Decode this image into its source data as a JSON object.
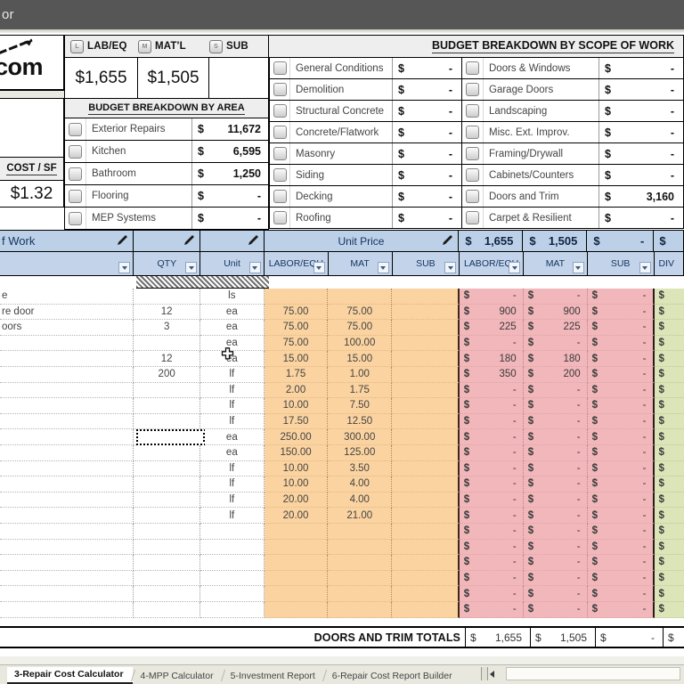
{
  "window": {
    "title": "or"
  },
  "summary": {
    "logo_text": "com",
    "cost_sf_label": "COST / SF",
    "cost_sf_value": "$1.32",
    "lms_header": [
      {
        "chip": "L",
        "label": "LAB/EQ"
      },
      {
        "chip": "M",
        "label": "MAT'L"
      },
      {
        "chip": "S",
        "label": "SUB"
      }
    ],
    "lms_values": [
      "$1,655",
      "$1,505",
      ""
    ],
    "area_title": "BUDGET BREAKDOWN BY AREA",
    "areas": [
      {
        "name": "Exterior Repairs",
        "amount": "11,672"
      },
      {
        "name": "Kitchen",
        "amount": "6,595"
      },
      {
        "name": "Bathroom",
        "amount": "1,250"
      },
      {
        "name": "Flooring",
        "amount": "-"
      },
      {
        "name": "MEP Systems",
        "amount": "-"
      }
    ],
    "scope_title": "BUDGET BREAKDOWN BY SCOPE OF WORK",
    "scope_left": [
      {
        "name": "General Conditions",
        "amount": "-"
      },
      {
        "name": "Demolition",
        "amount": "-"
      },
      {
        "name": "Structural Concrete",
        "amount": "-"
      },
      {
        "name": "Concrete/Flatwork",
        "amount": "-"
      },
      {
        "name": "Masonry",
        "amount": "-"
      },
      {
        "name": "Siding",
        "amount": "-"
      },
      {
        "name": "Decking",
        "amount": "-"
      },
      {
        "name": "Roofing",
        "amount": "-"
      }
    ],
    "scope_right": [
      {
        "name": "Doors & Windows",
        "amount": "-"
      },
      {
        "name": "Garage Doors",
        "amount": "-"
      },
      {
        "name": "Landscaping",
        "amount": "-"
      },
      {
        "name": "Misc. Ext. Improv.",
        "amount": "-"
      },
      {
        "name": "Framing/Drywall",
        "amount": "-"
      },
      {
        "name": "Cabinets/Counters",
        "amount": "-"
      },
      {
        "name": "Doors and Trim",
        "amount": "3,160"
      },
      {
        "name": "Carpet & Resilient",
        "amount": "-"
      }
    ]
  },
  "table_header": {
    "scope_of_work": "f Work",
    "qty": "QTY",
    "unit": "Unit",
    "unit_price_group": "Unit Price",
    "totals_row": [
      {
        "dollar": "$",
        "amount": "1,655"
      },
      {
        "dollar": "$",
        "amount": "1,505"
      },
      {
        "dollar": "$",
        "amount": "-"
      },
      {
        "dollar": "$",
        "amount": ""
      }
    ],
    "sub_labels_unit_price": [
      "LABOR/EQU",
      "MAT",
      "SUB"
    ],
    "sub_labels_extended": [
      "LABOR/EQU",
      "MAT",
      "SUB"
    ],
    "div_label": "DIV"
  },
  "rows": [
    {
      "desc": "e",
      "qty": "",
      "unit": "ls",
      "up_lab": "",
      "up_mat": "",
      "up_sub": "",
      "ex_lab": "-",
      "ex_mat": "-",
      "ex_sub": "-"
    },
    {
      "desc": "re door",
      "qty": "12",
      "unit": "ea",
      "up_lab": "75.00",
      "up_mat": "75.00",
      "up_sub": "",
      "ex_lab": "900",
      "ex_mat": "900",
      "ex_sub": "-"
    },
    {
      "desc": "oors",
      "qty": "3",
      "unit": "ea",
      "up_lab": "75.00",
      "up_mat": "75.00",
      "up_sub": "",
      "ex_lab": "225",
      "ex_mat": "225",
      "ex_sub": "-"
    },
    {
      "desc": "",
      "qty": "",
      "unit": "ea",
      "up_lab": "75.00",
      "up_mat": "100.00",
      "up_sub": "",
      "ex_lab": "-",
      "ex_mat": "-",
      "ex_sub": "-"
    },
    {
      "desc": "",
      "qty": "12",
      "unit": "ea",
      "up_lab": "15.00",
      "up_mat": "15.00",
      "up_sub": "",
      "ex_lab": "180",
      "ex_mat": "180",
      "ex_sub": "-"
    },
    {
      "desc": "",
      "qty": "200",
      "unit": "lf",
      "up_lab": "1.75",
      "up_mat": "1.00",
      "up_sub": "",
      "ex_lab": "350",
      "ex_mat": "200",
      "ex_sub": "-"
    },
    {
      "desc": "",
      "qty": "",
      "unit": "lf",
      "up_lab": "2.00",
      "up_mat": "1.75",
      "up_sub": "",
      "ex_lab": "-",
      "ex_mat": "-",
      "ex_sub": "-"
    },
    {
      "desc": "",
      "qty": "",
      "unit": "lf",
      "up_lab": "10.00",
      "up_mat": "7.50",
      "up_sub": "",
      "ex_lab": "-",
      "ex_mat": "-",
      "ex_sub": "-"
    },
    {
      "desc": "",
      "qty": "",
      "unit": "lf",
      "up_lab": "17.50",
      "up_mat": "12.50",
      "up_sub": "",
      "ex_lab": "-",
      "ex_mat": "-",
      "ex_sub": "-"
    },
    {
      "desc": "",
      "qty": "",
      "unit": "ea",
      "up_lab": "250.00",
      "up_mat": "300.00",
      "up_sub": "",
      "ex_lab": "-",
      "ex_mat": "-",
      "ex_sub": "-"
    },
    {
      "desc": "",
      "qty": "",
      "unit": "ea",
      "up_lab": "150.00",
      "up_mat": "125.00",
      "up_sub": "",
      "ex_lab": "-",
      "ex_mat": "-",
      "ex_sub": "-"
    },
    {
      "desc": "",
      "qty": "",
      "unit": "lf",
      "up_lab": "10.00",
      "up_mat": "3.50",
      "up_sub": "",
      "ex_lab": "-",
      "ex_mat": "-",
      "ex_sub": "-"
    },
    {
      "desc": "",
      "qty": "",
      "unit": "lf",
      "up_lab": "10.00",
      "up_mat": "4.00",
      "up_sub": "",
      "ex_lab": "-",
      "ex_mat": "-",
      "ex_sub": "-"
    },
    {
      "desc": "",
      "qty": "",
      "unit": "lf",
      "up_lab": "20.00",
      "up_mat": "4.00",
      "up_sub": "",
      "ex_lab": "-",
      "ex_mat": "-",
      "ex_sub": "-"
    },
    {
      "desc": "",
      "qty": "",
      "unit": "lf",
      "up_lab": "20.00",
      "up_mat": "21.00",
      "up_sub": "",
      "ex_lab": "-",
      "ex_mat": "-",
      "ex_sub": "-"
    },
    {
      "desc": "",
      "qty": "",
      "unit": "",
      "up_lab": "",
      "up_mat": "",
      "up_sub": "",
      "ex_lab": "-",
      "ex_mat": "-",
      "ex_sub": "-"
    },
    {
      "desc": "",
      "qty": "",
      "unit": "",
      "up_lab": "",
      "up_mat": "",
      "up_sub": "",
      "ex_lab": "-",
      "ex_mat": "-",
      "ex_sub": "-"
    },
    {
      "desc": "",
      "qty": "",
      "unit": "",
      "up_lab": "",
      "up_mat": "",
      "up_sub": "",
      "ex_lab": "-",
      "ex_mat": "-",
      "ex_sub": "-"
    },
    {
      "desc": "",
      "qty": "",
      "unit": "",
      "up_lab": "",
      "up_mat": "",
      "up_sub": "",
      "ex_lab": "-",
      "ex_mat": "-",
      "ex_sub": "-"
    },
    {
      "desc": "",
      "qty": "",
      "unit": "",
      "up_lab": "",
      "up_mat": "",
      "up_sub": "",
      "ex_lab": "-",
      "ex_mat": "-",
      "ex_sub": "-"
    },
    {
      "desc": "",
      "qty": "",
      "unit": "",
      "up_lab": "",
      "up_mat": "",
      "up_sub": "",
      "ex_lab": "-",
      "ex_mat": "-",
      "ex_sub": "-"
    }
  ],
  "totals": {
    "label": "DOORS AND TRIM TOTALS",
    "values": [
      {
        "dollar": "$",
        "amount": "1,655"
      },
      {
        "dollar": "$",
        "amount": "1,505"
      },
      {
        "dollar": "$",
        "amount": "-"
      },
      {
        "dollar": "$",
        "amount": ""
      }
    ]
  },
  "tabs": [
    {
      "label": "3-Repair Cost Calculator",
      "active": true
    },
    {
      "label": "4-MPP Calculator",
      "active": false
    },
    {
      "label": "5-Investment Report",
      "active": false
    },
    {
      "label": "6-Repair Cost Report Builder",
      "active": false
    }
  ],
  "colors": {
    "header_blue": "#bcd0e8",
    "unit_price_orange": "#fbd3a0",
    "extended_pink": "#f1b7bb",
    "division_green": "#dbe5b8",
    "titlebar_gray": "#565656"
  }
}
